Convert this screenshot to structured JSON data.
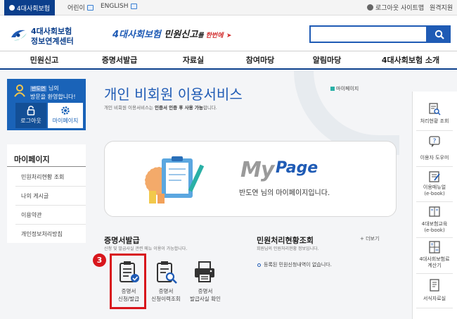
{
  "topbar": {
    "main_tab": "4대사회보험",
    "children": "어린이",
    "english": "ENGLISH",
    "logout": "로그아웃",
    "sitemap": "사이트맵",
    "remote_support": "원격지원"
  },
  "header": {
    "logo_line1": "4대사회보험",
    "logo_line2": "정보연계센터",
    "banner_main": "4대사회보험",
    "banner_mid": " 민원신고",
    "banner_small": "를 ",
    "banner_end": "한번에",
    "search_placeholder": ""
  },
  "nav": [
    "민원신고",
    "증명서발급",
    "자료실",
    "참여마당",
    "알림마당",
    "4대사회보험 소개"
  ],
  "login": {
    "user_name": "반도연",
    "name_suffix": " 님의",
    "welcome": "방문을 환영합니다!",
    "logout_label": "로그아웃",
    "mypage_label": "마이페이지"
  },
  "leftmenu": {
    "title": "마이페이지",
    "items": [
      "민원처리현황 조회",
      "나의 게시글",
      "이용약관",
      "개인정보처리방침"
    ]
  },
  "main": {
    "title": "개인 비회원 이용서비스",
    "subtitle_pre": "개인 비회원 이용서비스는 ",
    "subtitle_bold": "인증서 인증 후 사용 가능",
    "subtitle_post": "합니다.",
    "badge": "마이페이지",
    "card_my": "My",
    "card_page": "Page",
    "card_message": "반도연 님의 마이페이지입니다."
  },
  "cert_section": {
    "title": "증명서발급",
    "desc": "신청 및 발급사실 관련 메뉴 이용이 가능합니다.",
    "items": [
      {
        "line1": "증명서",
        "line2": "신청/발급"
      },
      {
        "line1": "증명서",
        "line2": "신청이력조회"
      },
      {
        "line1": "증명서",
        "line2": "발급사실 확인"
      }
    ],
    "step": "3"
  },
  "status_section": {
    "title": "민원처리현황조회",
    "desc": "회원님의 민원처리현황 정보입니다.",
    "more": "+ 더보기",
    "empty": "등록된 민원신청내역이 없습니다."
  },
  "quick_menu": [
    {
      "line1": "처리현황 조회",
      "line2": ""
    },
    {
      "line1": "이용자 도우미",
      "line2": ""
    },
    {
      "line1": "이용매뉴얼",
      "line2": "(e-book)"
    },
    {
      "line1": "4대보험교육",
      "line2": "(e-book)"
    },
    {
      "line1": "4대사회보험료",
      "line2": "계산기"
    },
    {
      "line1": "서식자료실",
      "line2": ""
    }
  ],
  "colors": {
    "brand": "#1f5bb5",
    "dark_brand": "#0b3f8c",
    "highlight": "#d8161c"
  }
}
